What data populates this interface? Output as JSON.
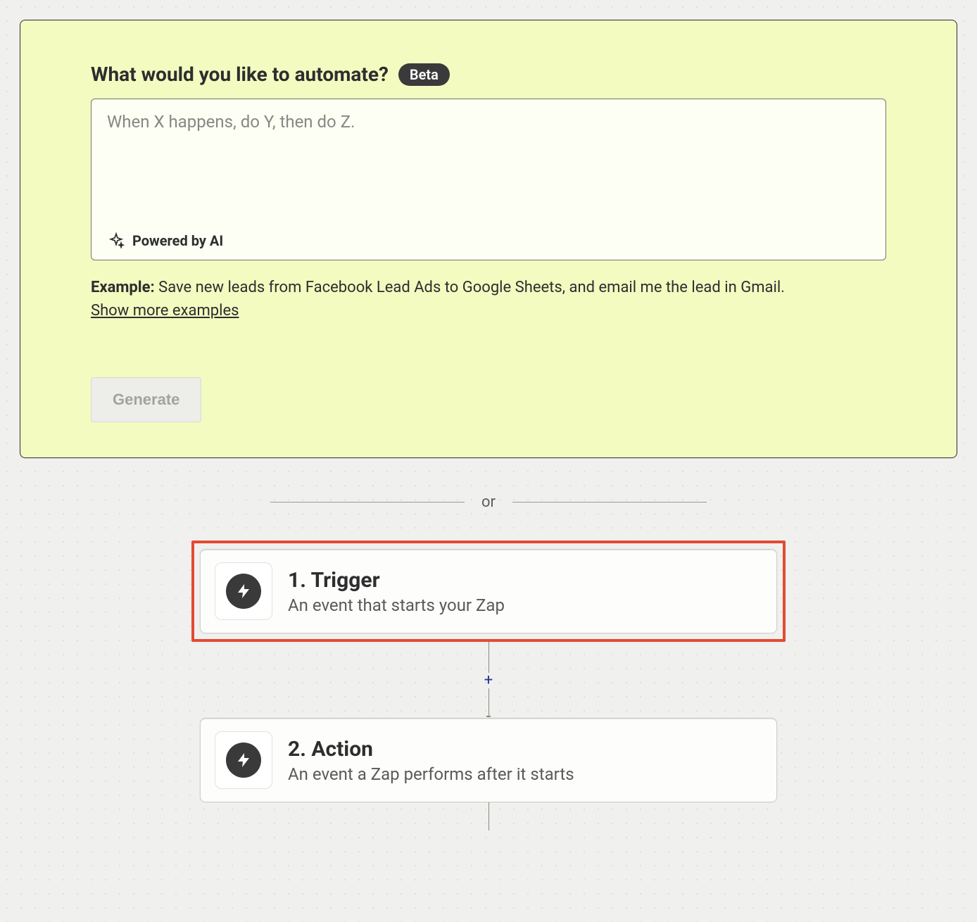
{
  "ai": {
    "heading": "What would you like to automate?",
    "badge": "Beta",
    "placeholder": "When X happens, do Y, then do Z.",
    "value": "",
    "powered_label": "Powered by AI",
    "example_label": "Example:",
    "example_text": " Save new leads from Facebook Lead Ads to Google Sheets, and email me the lead in Gmail.",
    "more_examples": "Show more examples",
    "generate_label": "Generate"
  },
  "divider": {
    "or": "or"
  },
  "steps": [
    {
      "title": "1. Trigger",
      "desc": "An event that starts your Zap",
      "highlighted": true
    },
    {
      "title": "2. Action",
      "desc": "An event a Zap performs after it starts",
      "highlighted": false
    }
  ]
}
